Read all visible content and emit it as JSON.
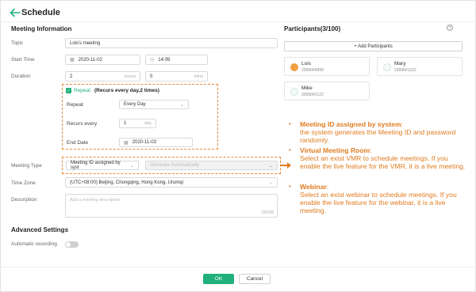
{
  "header": {
    "title": "Schedule"
  },
  "meeting_info": {
    "section_title": "Meeting Information",
    "topic": {
      "label": "Topic",
      "value": "Lois's meeting"
    },
    "start_time": {
      "label": "Start Time",
      "date": "2020-11-02",
      "time": "14:09"
    },
    "duration": {
      "label": "Duration",
      "hours_value": "2",
      "hours_unit": "hours",
      "mins_value": "0",
      "mins_unit": "mins"
    },
    "repeat": {
      "checkbox_label": "Repeat",
      "note": "(Recurs every day,2 times)",
      "repeat_label": "Repeat",
      "repeat_value": "Every Day",
      "recurs_label": "Recurs every",
      "recurs_value": "1",
      "recurs_unit": "day",
      "end_label": "End Date",
      "end_value": "2020-11-03"
    },
    "meeting_type": {
      "label": "Meeting Type",
      "value": "Meeting ID assigned by syst",
      "secondary_value": "Generate Automatically"
    },
    "time_zone": {
      "label": "Time Zone",
      "value": "(UTC+08:00) Beijing, Chongqing, Hong Kong, Urumqi"
    },
    "description": {
      "label": "Description",
      "placeholder": "Add a meeting description",
      "counter": "0/2000"
    }
  },
  "advanced": {
    "section_title": "Advanced Settings",
    "recording_label": "Automatic recording"
  },
  "participants": {
    "title": "Participants(3/100)",
    "add_label": "+ Add Participants",
    "list": [
      {
        "name": "Lois",
        "number": "23990#9999"
      },
      {
        "name": "Mary",
        "number": "23990#1222"
      },
      {
        "name": "Mike",
        "number": "33990#2122"
      }
    ]
  },
  "footer": {
    "ok_label": "OK",
    "cancel_label": "Cancel"
  },
  "annotations": [
    {
      "title": "Meeting ID assigned by system",
      "suffix": ":",
      "body": "the system generates the Meeting ID and password randomly."
    },
    {
      "title": "Virtual Meeting Room",
      "suffix": ":",
      "body": "Select an exist VMR to schedule meetings. If you enable the live feature for the VMR, it is a live meeting."
    },
    {
      "title": "Webinar",
      "suffix": ":",
      "body": "Select an exist webinar to schedule meetings. If you enable the live feature for the webinar, it is a live meeting."
    }
  ],
  "colors": {
    "accent": "#21b07c",
    "annotation": "#e07b20",
    "dashed": "#e88a3a"
  }
}
